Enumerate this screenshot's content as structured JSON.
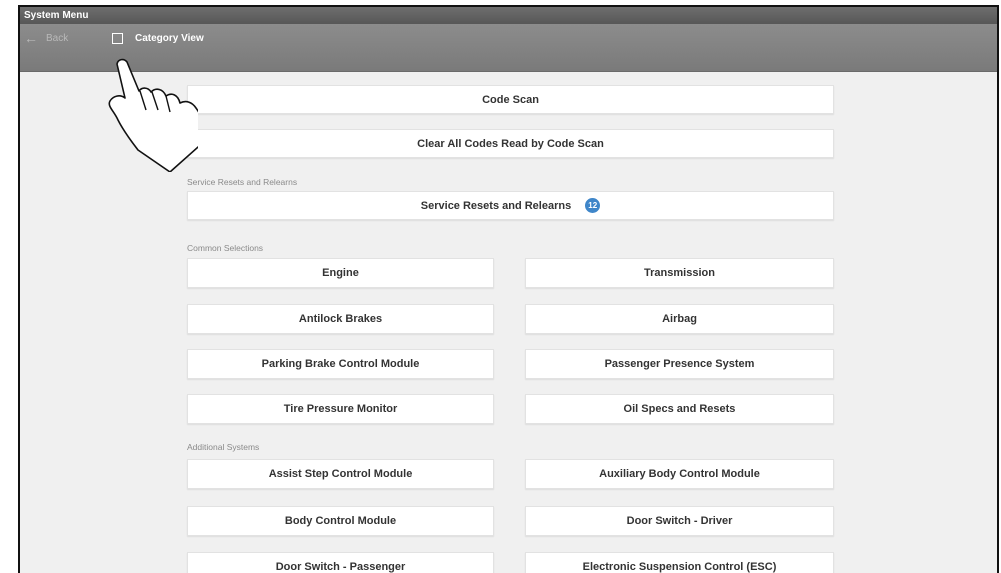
{
  "window": {
    "title": "System Menu"
  },
  "nav": {
    "back_label": "Back",
    "category_view_label": "Category View"
  },
  "buttons": {
    "code_scan": "Code Scan",
    "clear_codes": "Clear All Codes Read by Code Scan"
  },
  "sections": {
    "service": {
      "label": "Service Resets and Relearns",
      "button_label": "Service Resets and Relearns",
      "badge_count": "12"
    },
    "common": {
      "label": "Common Selections",
      "items": [
        "Engine",
        "Transmission",
        "Antilock Brakes",
        "Airbag",
        "Parking Brake Control Module",
        "Passenger Presence System",
        "Tire Pressure Monitor",
        "Oil Specs and Resets"
      ]
    },
    "additional": {
      "label": "Additional Systems",
      "items": [
        "Assist Step Control Module",
        "Auxiliary Body Control Module",
        "Body Control Module",
        "Door Switch - Driver",
        "Door Switch - Passenger",
        "Electronic Suspension Control (ESC)"
      ]
    }
  },
  "colors": {
    "badge": "#3f86c9",
    "titlebar": "#575757",
    "navbar": "#7a7a7a"
  }
}
